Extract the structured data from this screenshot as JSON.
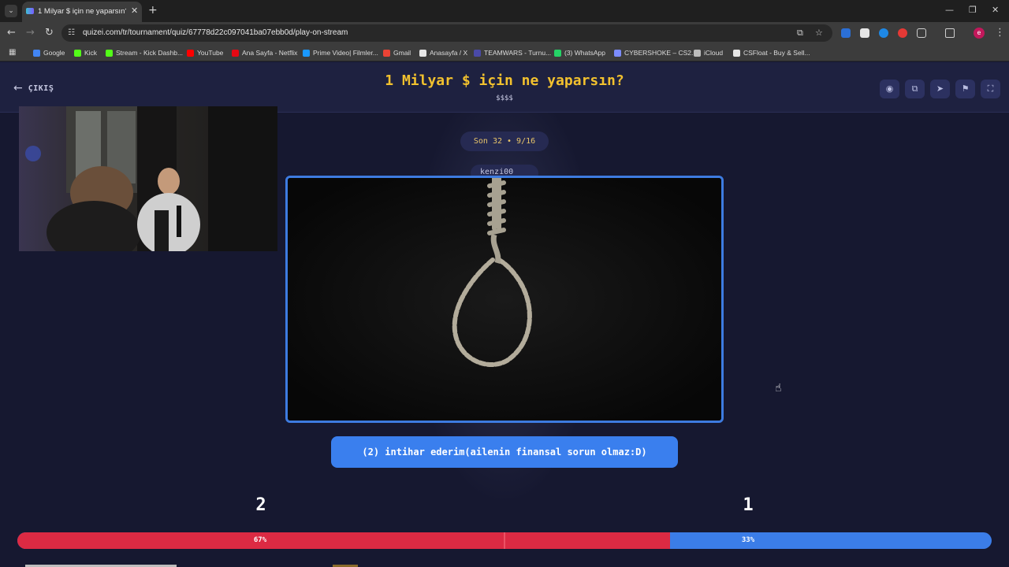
{
  "browser": {
    "tab_title": "1 Milyar $ için ne yaparsın? - Qu",
    "url": "quizei.com/tr/tournament/quiz/67778d22c097041ba07ebb0d/play-on-stream",
    "bookmarks": [
      {
        "label": "Google",
        "icon_color": "#4285f4"
      },
      {
        "label": "Kick",
        "icon_color": "#53fc18"
      },
      {
        "label": "Stream - Kick Dashb...",
        "icon_color": "#53fc18"
      },
      {
        "label": "YouTube",
        "icon_color": "#ff0000"
      },
      {
        "label": "Ana Sayfa - Netflix",
        "icon_color": "#e50914"
      },
      {
        "label": "Prime Video| Filmler...",
        "icon_color": "#1a98ff"
      },
      {
        "label": "Gmail",
        "icon_color": "#ea4335"
      },
      {
        "label": "Anasayfa / X",
        "icon_color": "#e7e7e7"
      },
      {
        "label": "TEAMWARS - Turnu...",
        "icon_color": "#4a4aa8"
      },
      {
        "label": "(3) WhatsApp",
        "icon_color": "#25d366"
      },
      {
        "label": "CYBERSHOKE – CS2...",
        "icon_color": "#7c8cff"
      },
      {
        "label": "iCloud",
        "icon_color": "#bdbdbd"
      },
      {
        "label": "CSFloat - Buy & Sell...",
        "icon_color": "#e6e6e6"
      }
    ]
  },
  "header": {
    "exit_label": "ÇIKIŞ",
    "title": "1 Milyar $ için ne yaparsın?",
    "subtitle": "$$$$"
  },
  "round": {
    "label": "Son 32 • 9/16",
    "user": "kenzi00"
  },
  "answer": {
    "label": "(2) intihar ederim(ailenin finansal sorun olmaz:D)"
  },
  "votes": {
    "left_count": "2",
    "right_count": "1",
    "left_percent_label": "67%",
    "right_percent_label": "33%",
    "left_fraction": 0.67,
    "left_color": "#dc2a43",
    "right_color": "#3b7de8"
  },
  "colors": {
    "title": "#f2c12e",
    "accent": "#3a7fee",
    "background": "#161830"
  }
}
